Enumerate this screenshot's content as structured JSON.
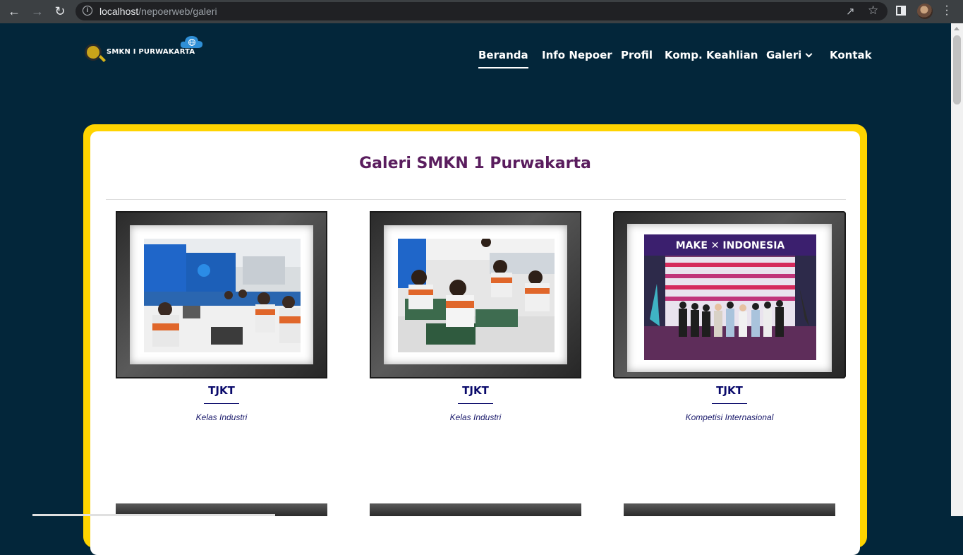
{
  "browser": {
    "url_host": "localhost",
    "url_path": "/nepoerweb/galeri"
  },
  "site": {
    "logo_text": "SMKN I PURWAKARTA",
    "nav": [
      {
        "label": "Beranda"
      },
      {
        "label": "Info Nepoer"
      },
      {
        "label": "Profil"
      },
      {
        "label": "Komp. Keahlian"
      },
      {
        "label": "Galeri"
      },
      {
        "label": "Kontak"
      }
    ]
  },
  "gallery": {
    "title": "Galeri SMKN 1 Purwakarta",
    "items": [
      {
        "title": "TJKT",
        "desc": "Kelas Industri"
      },
      {
        "title": "TJKT",
        "desc": "Kelas Industri"
      },
      {
        "title": "TJKT",
        "desc": "Kompetisi Internasional",
        "banner_text": "MAKE ✕ INDONESIA"
      }
    ]
  },
  "colors": {
    "page_bg": "#03263a",
    "card_border": "#ffd400",
    "title_color": "#5a1d5e",
    "caption_color": "#0a0a6b"
  }
}
